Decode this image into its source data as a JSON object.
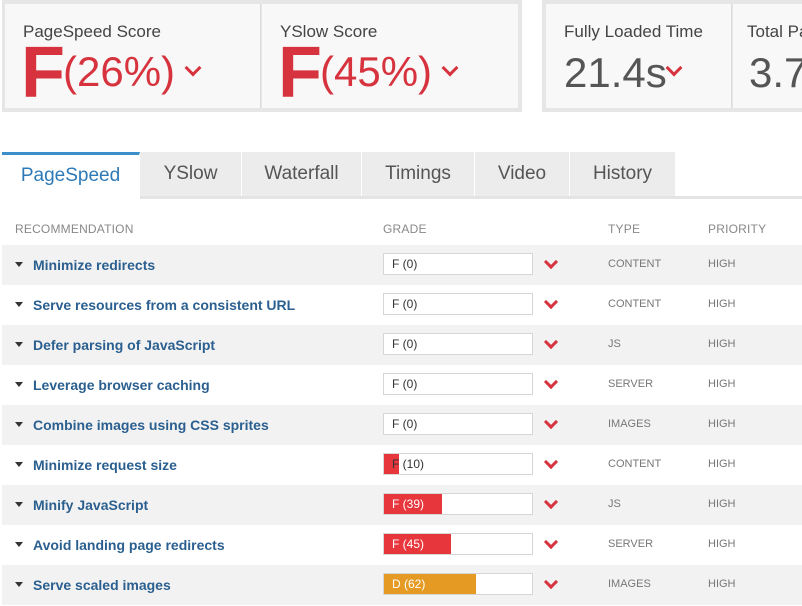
{
  "scores": {
    "pagespeed": {
      "label": "PageSpeed Score",
      "grade": "F",
      "percent": "(26%)"
    },
    "yslow": {
      "label": "YSlow Score",
      "grade": "F",
      "percent": "(45%)"
    },
    "loaded": {
      "label": "Fully Loaded Time",
      "value": "21.4s"
    },
    "total": {
      "label": "Total Pa",
      "value": "3.7"
    }
  },
  "tabs": [
    {
      "label": "PageSpeed",
      "active": true
    },
    {
      "label": "YSlow"
    },
    {
      "label": "Waterfall"
    },
    {
      "label": "Timings"
    },
    {
      "label": "Video"
    },
    {
      "label": "History"
    }
  ],
  "table": {
    "headers": {
      "recommendation": "RECOMMENDATION",
      "grade": "GRADE",
      "type": "TYPE",
      "priority": "PRIORITY"
    },
    "rows": [
      {
        "name": "Minimize redirects",
        "grade": "F (0)",
        "score": 0,
        "type": "CONTENT",
        "priority": "HIGH"
      },
      {
        "name": "Serve resources from a consistent URL",
        "grade": "F (0)",
        "score": 0,
        "type": "CONTENT",
        "priority": "HIGH"
      },
      {
        "name": "Defer parsing of JavaScript",
        "grade": "F (0)",
        "score": 0,
        "type": "JS",
        "priority": "HIGH"
      },
      {
        "name": "Leverage browser caching",
        "grade": "F (0)",
        "score": 0,
        "type": "SERVER",
        "priority": "HIGH"
      },
      {
        "name": "Combine images using CSS sprites",
        "grade": "F (0)",
        "score": 0,
        "type": "IMAGES",
        "priority": "HIGH"
      },
      {
        "name": "Minimize request size",
        "grade": "F (10)",
        "score": 10,
        "type": "CONTENT",
        "priority": "HIGH"
      },
      {
        "name": "Minify JavaScript",
        "grade": "F (39)",
        "score": 39,
        "type": "JS",
        "priority": "HIGH"
      },
      {
        "name": "Avoid landing page redirects",
        "grade": "F (45)",
        "score": 45,
        "type": "SERVER",
        "priority": "HIGH"
      },
      {
        "name": "Serve scaled images",
        "grade": "D (62)",
        "score": 62,
        "type": "IMAGES",
        "priority": "HIGH"
      }
    ]
  },
  "colors": {
    "fail": "#e8363d",
    "warn": "#e59a24",
    "accent": "#3d8fcc",
    "link": "#2a5f8f"
  }
}
